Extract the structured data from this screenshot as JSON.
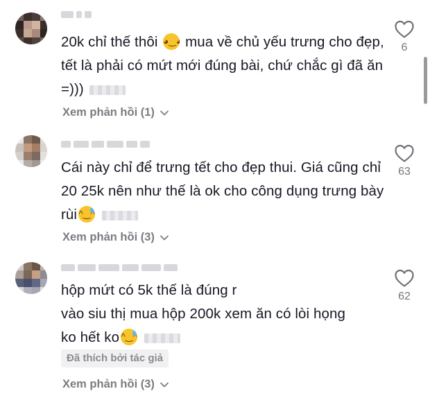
{
  "comments": [
    {
      "text_before": "20k chỉ thế thôi ",
      "emoji1": "rofl",
      "text_after": " mua về chủ yếu trưng cho đẹp, tết là phải có mứt mới đúng bài, chứ chắc gì đã ăn =)))",
      "likes": "6",
      "replies": "Xem phản hồi (1)"
    },
    {
      "text_before": "Cái này chỉ để trưng tết cho đẹp thui. Giá cũng chỉ 20 25k nên như thế là ok cho công dụng trưng bày rùi",
      "emoji1": "sweat-smile",
      "likes": "63",
      "replies": "Xem phản hồi (3)"
    },
    {
      "line1": "hộp mứt có 5k thế là đúng r",
      "line2": "vào siu thị mua hộp 200k xem ăn có lòi họng",
      "line3": "ko hết ko",
      "emoji1": "sweat-smile",
      "likes": "62",
      "badge": "Đã thích bởi tác giả",
      "replies": "Xem phản hồi (3)"
    }
  ],
  "icons": {
    "like": "heart-outline-icon",
    "expand": "chevron-down-icon"
  },
  "colors": {
    "text": "#161823",
    "muted": "#7b7c82",
    "badge_bg": "#f1f1f2"
  }
}
